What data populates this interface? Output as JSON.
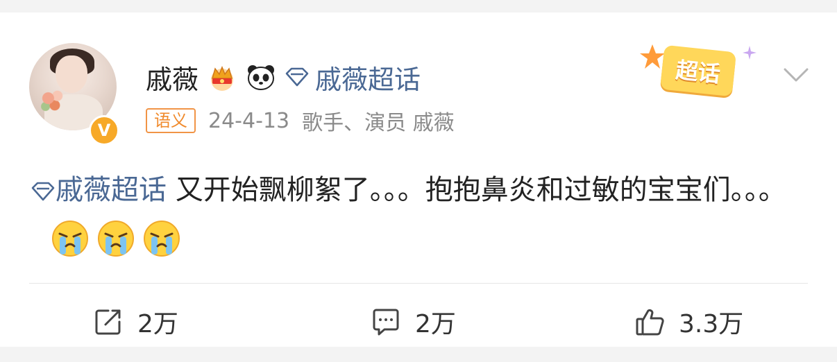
{
  "post": {
    "author": "戚薇",
    "author_supertopic": "戚薇超话",
    "tag": "语义",
    "date": "24-4-13",
    "meta": "歌手、演员 戚薇",
    "sticker_label": "超话",
    "content": {
      "topic": "戚薇超话",
      "text": " 又开始飘柳絮了。。。抱抱鼻炎和过敏的宝宝们。。。"
    },
    "emojis": [
      "crying-face",
      "crying-face",
      "crying-face"
    ]
  },
  "actions": {
    "repost": "2万",
    "comment": "2万",
    "like": "3.3万"
  },
  "colors": {
    "link": "#4a6894",
    "tag": "#f08a2c",
    "meta": "#8a8a8a"
  }
}
